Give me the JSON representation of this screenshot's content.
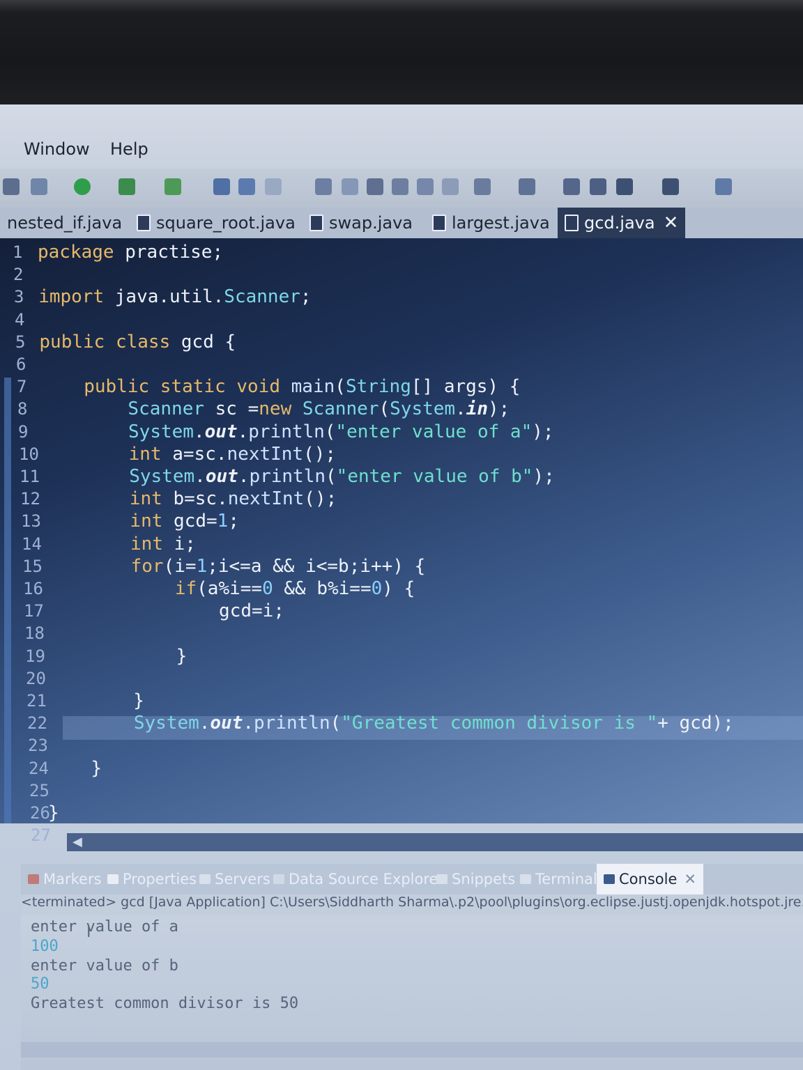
{
  "menu": [
    {
      "label": "Window"
    },
    {
      "label": "Help"
    }
  ],
  "toolbar": {
    "icons": [
      "debug-icon",
      "run-icon",
      "run-config-icon",
      "external-tools-icon",
      "new-package-icon",
      "open-icon",
      "edit-icon",
      "search-icon",
      "pin-icon",
      "annotation-icon",
      "toggle-icon",
      "paragraph-icon",
      "nav-icon",
      "prev-edit-icon",
      "next-edit-icon",
      "back-icon",
      "forward-icon",
      "perspective-icon"
    ]
  },
  "tabs": [
    {
      "label": "nested_if.java"
    },
    {
      "label": "square_root.java"
    },
    {
      "label": "swap.java"
    },
    {
      "label": "largest.java"
    },
    {
      "label": "gcd.java",
      "active": true,
      "close": "✕"
    }
  ],
  "editor": {
    "line_numbers": [
      "1",
      "2",
      "3",
      "4",
      "5",
      "6",
      "7",
      "8",
      "9",
      "10",
      "11",
      "12",
      "13",
      "14",
      "15",
      "16",
      "17",
      "18",
      "19",
      "20",
      "21",
      "22",
      "23",
      "24",
      "25",
      "26",
      "27"
    ],
    "lines": [
      "package practise;",
      "",
      "import java.util.Scanner;",
      "",
      "public class gcd {",
      "",
      "    public static void main(String[] args) {",
      "        Scanner sc =new Scanner(System.in);",
      "        System.out.println(\"enter value of a\");",
      "        int a=sc.nextInt();",
      "        System.out.println(\"enter value of b\");",
      "        int b=sc.nextInt();",
      "        int gcd=1;",
      "        int i;",
      "        for(i=1;i<=a && i<=b;i++) {",
      "            if(a%i==0 && b%i==0) {",
      "                gcd=i;",
      "",
      "            }",
      "",
      "        }",
      "        System.out.println(\"Greatest common divisor is \"+ gcd);",
      "",
      "    }",
      "",
      "}",
      ""
    ]
  },
  "panel": {
    "tabs": [
      {
        "label": "Markers"
      },
      {
        "label": "Properties"
      },
      {
        "label": "Servers"
      },
      {
        "label": "Data Source Explorer"
      },
      {
        "label": "Snippets"
      },
      {
        "label": "Terminal"
      },
      {
        "label": "Console",
        "active": true,
        "close": "✕"
      }
    ],
    "console_header": "<terminated> gcd [Java Application] C:\\Users\\Siddharth Sharma\\.p2\\pool\\plugins\\org.eclipse.justj.openjdk.hotspot.jre.full.",
    "output": [
      {
        "text": "enter value of a",
        "input": false
      },
      {
        "text": "100",
        "input": true
      },
      {
        "text": "enter value of b",
        "input": false
      },
      {
        "text": "50",
        "input": true
      },
      {
        "text": "Greatest common divisor is 50",
        "input": false
      }
    ]
  },
  "colors": {
    "keyword": "#e6b96a",
    "type": "#7fd7e8",
    "string": "#6fe0ce",
    "editor_bg": "#1d3157",
    "active_tab": "#2a3a57"
  }
}
